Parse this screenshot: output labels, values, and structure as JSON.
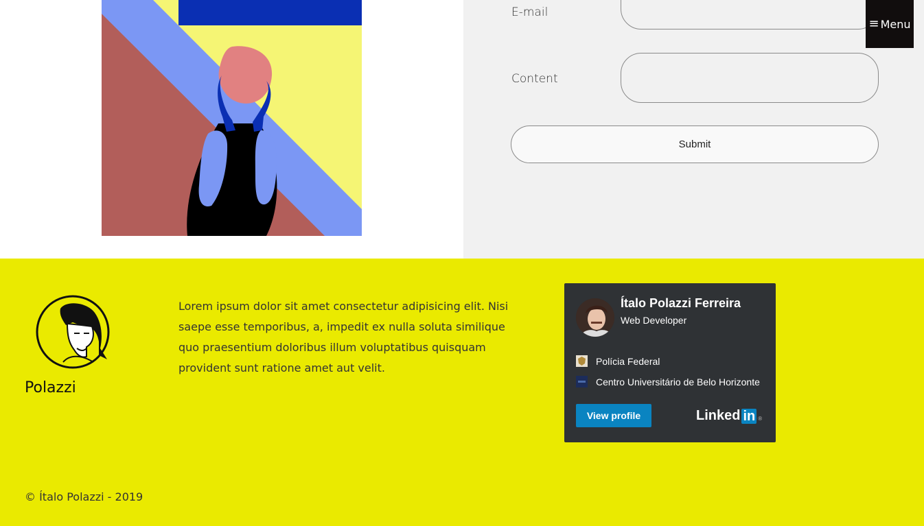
{
  "menu": {
    "icon": "hamburger-icon",
    "label": "Menu"
  },
  "artwork": {
    "name": "scream-illustration",
    "colors": {
      "navy": "#0a2fb3",
      "yellow": "#f5f574",
      "rose": "#b25e5a",
      "periwinkle": "#7b97f4",
      "skin": "#e18181",
      "black": "#000000"
    }
  },
  "contact_form": {
    "email_label": "E-mail",
    "email_value": "",
    "content_label": "Content",
    "content_value": "",
    "submit_label": "Submit"
  },
  "footer": {
    "background": "#eaea00",
    "brand": "Polazzi",
    "logo_icon": "face-portrait-icon",
    "description": "Lorem ipsum dolor sit amet consectetur adipisicing elit. Nisi saepe esse temporibus, a, impedit ex nulla soluta similique quo praesentium doloribus illum voluptatibus quisquam provident sunt ratione amet aut velit.",
    "copyright": "© Ítalo Polazzi - 2019"
  },
  "linkedin_badge": {
    "name": "Ítalo Polazzi Ferreira",
    "title": "Web Developer",
    "experience": "Polícia Federal",
    "education": "Centro Universitário de Belo Horizonte",
    "view_profile_label": "View profile",
    "logo_text": "Linked",
    "logo_in": "in",
    "logo_reg": "®",
    "colors": {
      "card": "#2f3235",
      "accent": "#0a84c1"
    }
  }
}
